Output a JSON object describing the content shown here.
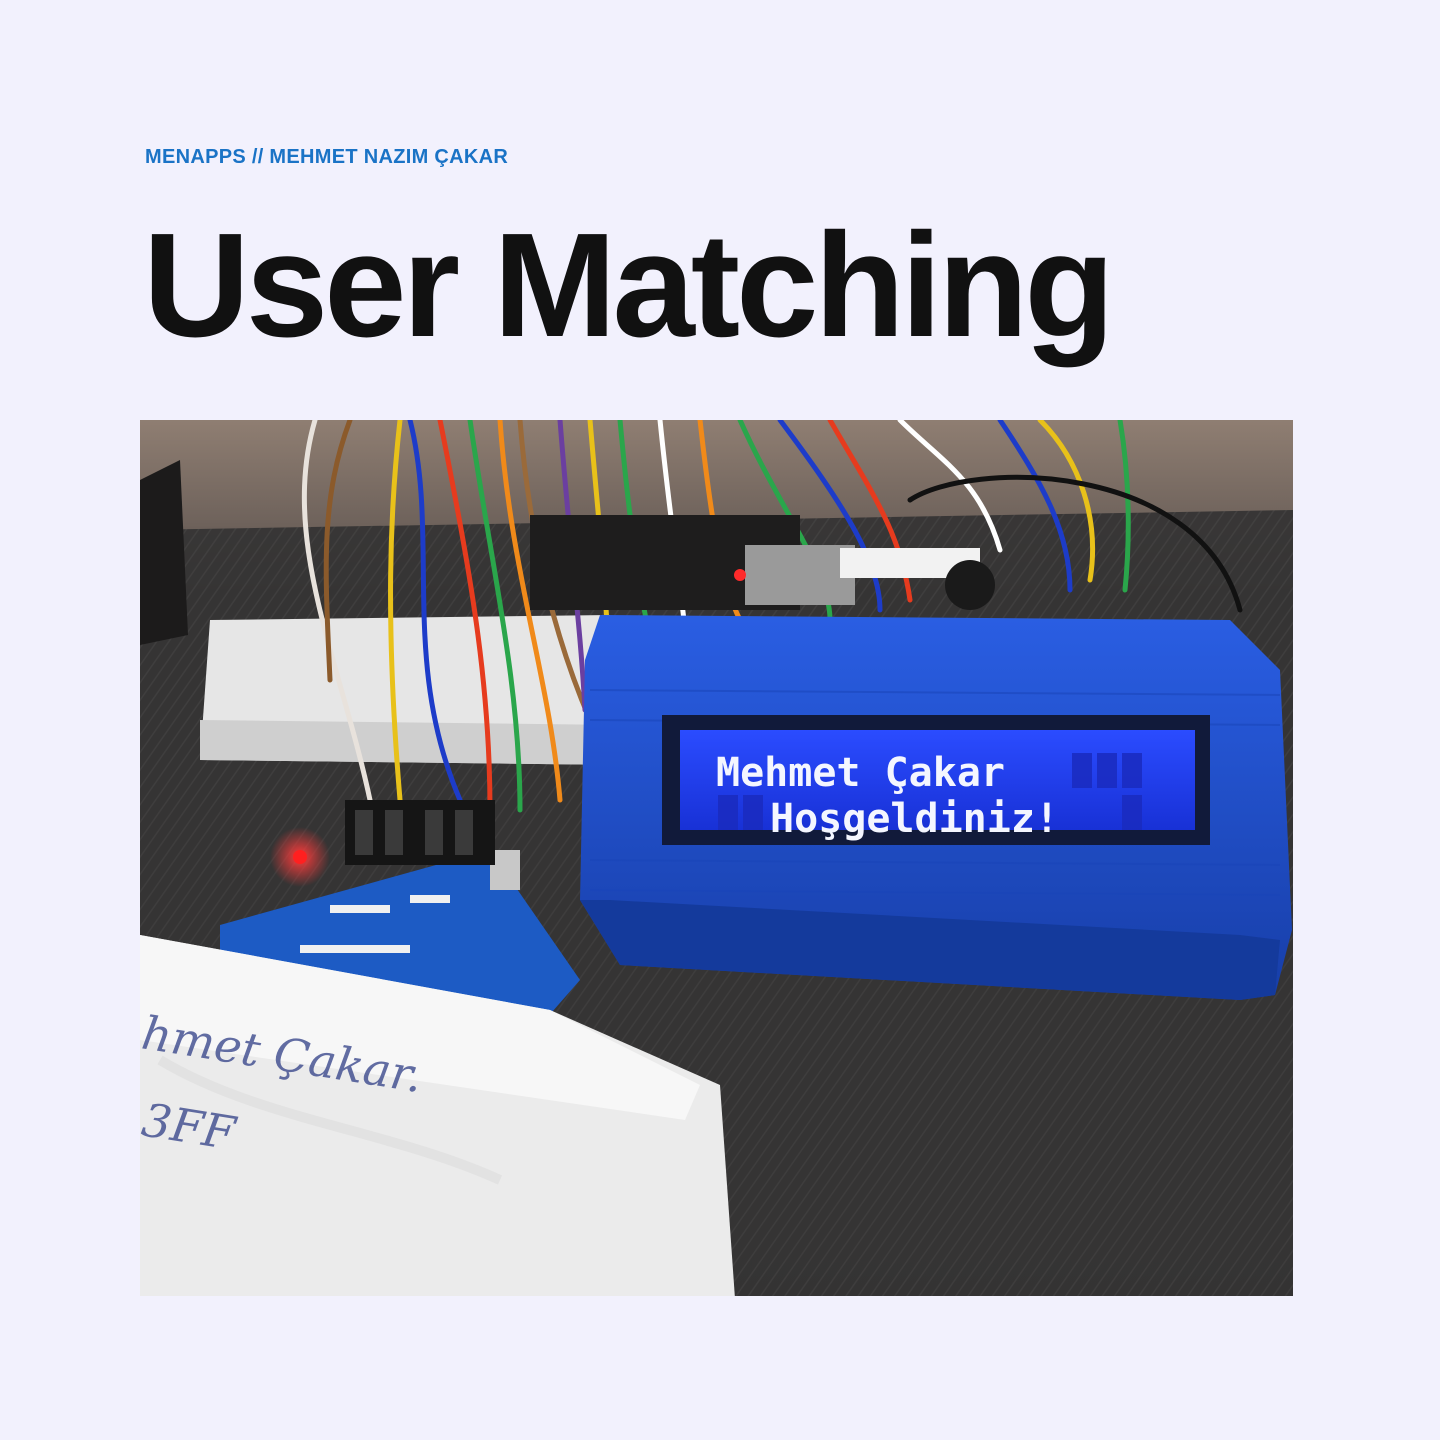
{
  "header": {
    "kicker": "MENAPPS // MEHMET NAZIM ÇAKAR",
    "title": "User Matching"
  },
  "photo": {
    "lcd_lines": [
      "Mehmet Çakar",
      "Hoşgeldiniz!"
    ],
    "card_handwriting": [
      "hmet Çakar.",
      "3FF"
    ]
  },
  "colors": {
    "background": "#f2f1fd",
    "kicker": "#1a73c6",
    "title": "#111111",
    "enclosure": "#1f4fd1",
    "lcd": "#1d3cf0"
  }
}
